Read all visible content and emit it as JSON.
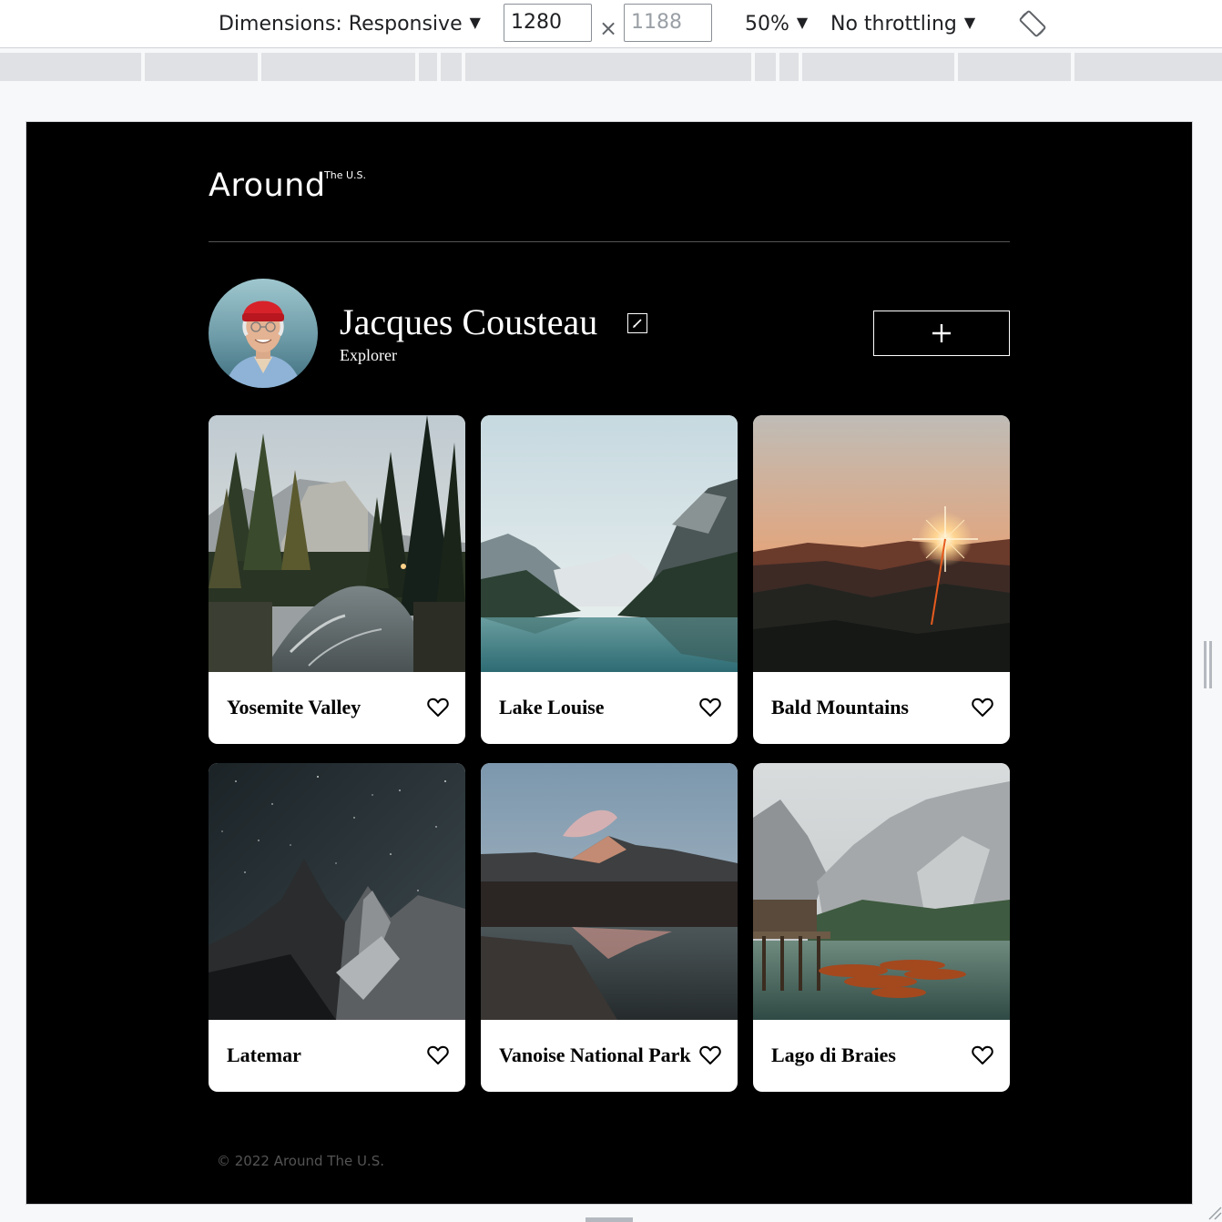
{
  "devtools": {
    "dimensions_label": "Dimensions: Responsive",
    "width_value": "1280",
    "height_placeholder": "1188",
    "times": "×",
    "zoom": "50%",
    "throttling": "No throttling",
    "caret": "▼"
  },
  "header": {
    "logo": "Around",
    "logo_sup": "The U.S."
  },
  "profile": {
    "name": "Jacques Cousteau",
    "job": "Explorer",
    "add_symbol": "+"
  },
  "cards": [
    {
      "title": "Yosemite Valley"
    },
    {
      "title": "Lake Louise"
    },
    {
      "title": "Bald Mountains"
    },
    {
      "title": "Latemar"
    },
    {
      "title": "Vanoise National Park"
    },
    {
      "title": "Lago di Braies"
    }
  ],
  "footer": {
    "copyright": "© 2022 Around The U.S."
  },
  "icons": {
    "edit": "pencil-icon",
    "add": "plus-icon",
    "like": "heart-outline-icon",
    "rotate": "rotate-device-icon"
  }
}
